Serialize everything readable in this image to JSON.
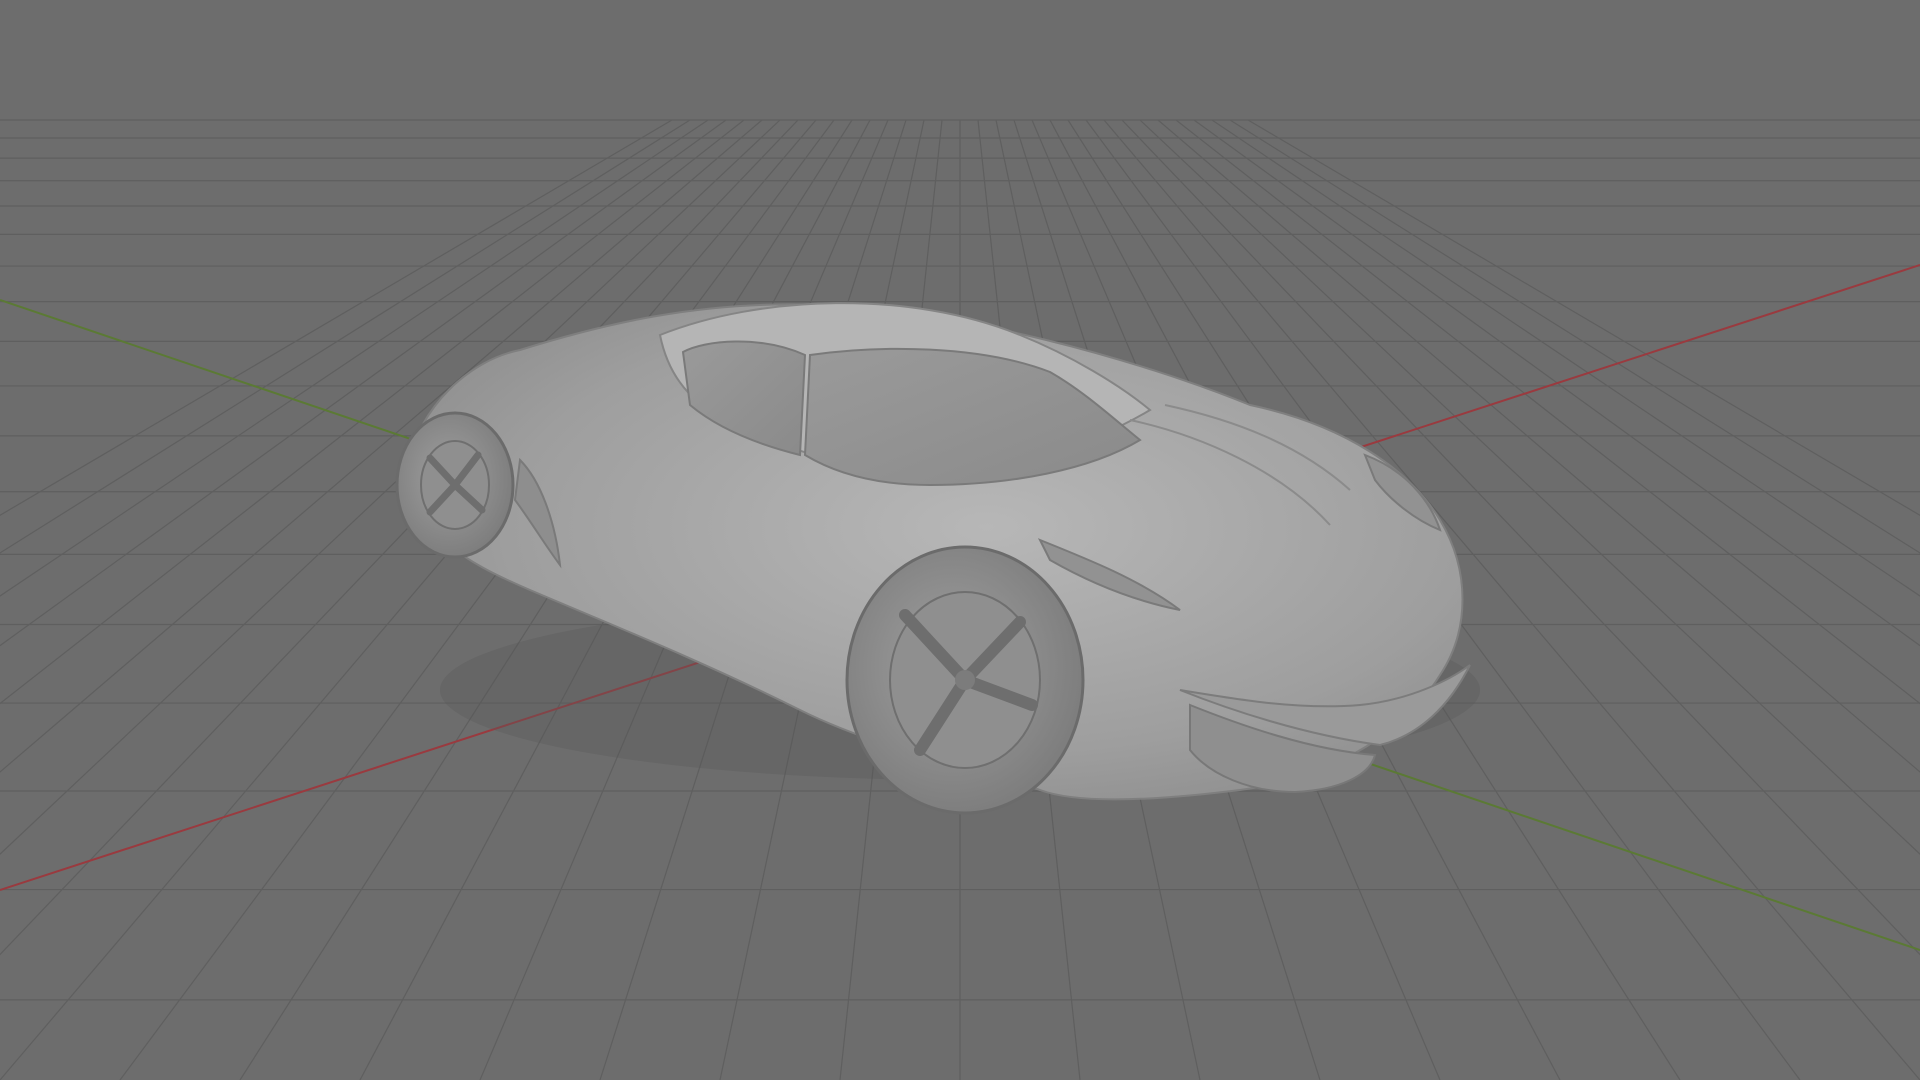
{
  "viewport": {
    "mode": "3D viewport",
    "shading": "solid",
    "background_color": "#6d6d6d",
    "grid_color": "#5f5f5f",
    "x_axis_color": "#9a3a3f",
    "y_axis_color": "#5b7a34"
  },
  "scene": {
    "object": "car-model",
    "object_color": "#a7a7a7",
    "floor_grid": true,
    "axes_visible": [
      "x",
      "y"
    ]
  }
}
